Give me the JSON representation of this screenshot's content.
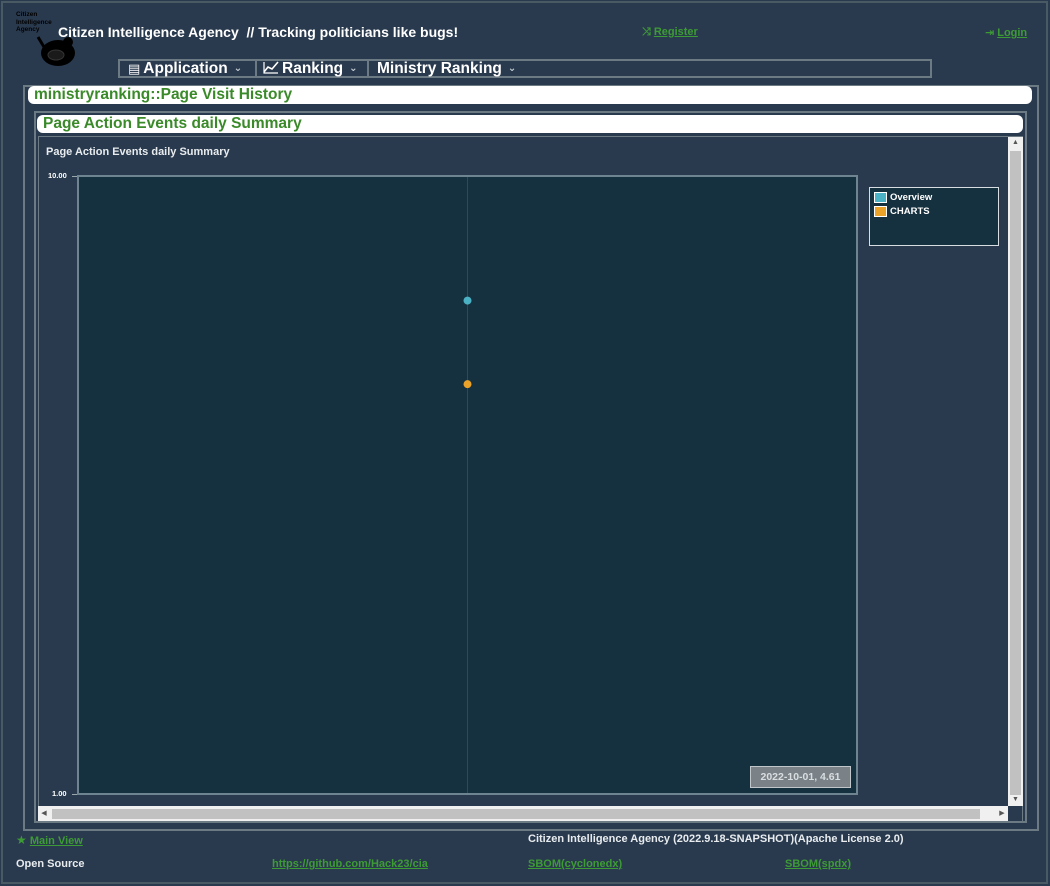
{
  "header": {
    "logo_text": [
      "Citizen",
      "Intelligence",
      "Agency"
    ],
    "brand": "Citizen Intelligence Agency  // Tracking politicians like bugs!",
    "register_label": "Register",
    "login_label": "Login"
  },
  "menu": {
    "items": [
      {
        "label": "Application"
      },
      {
        "label": "Ranking"
      },
      {
        "label": "Ministry Ranking"
      }
    ]
  },
  "page": {
    "title": "ministryranking::Page Visit History",
    "panel_title": "Page Action Events daily Summary"
  },
  "chart_data": {
    "type": "scatter",
    "title": "Page Action Events daily Summary",
    "yscale": "log",
    "ylim": [
      1,
      10
    ],
    "yticks": [
      "10.00",
      "1.00"
    ],
    "x": [
      "2022-10-01"
    ],
    "series": [
      {
        "name": "Overview",
        "color": "#4bb2c5",
        "values": [
          6.3
        ]
      },
      {
        "name": "CHARTS",
        "color": "#eaa228",
        "values": [
          4.61
        ]
      }
    ],
    "legend_position": "top-right",
    "tooltip": "2022-10-01, 4.61"
  },
  "footer": {
    "main_view": "Main View",
    "version": "Citizen Intelligence Agency (2022.9.18-SNAPSHOT)(Apache License 2.0)",
    "open_source": "Open Source",
    "github": "https://github.com/Hack23/cia",
    "sbom_cyclonedx": "SBOM(cyclonedx)",
    "sbom_spdx": "SBOM(spdx)"
  }
}
